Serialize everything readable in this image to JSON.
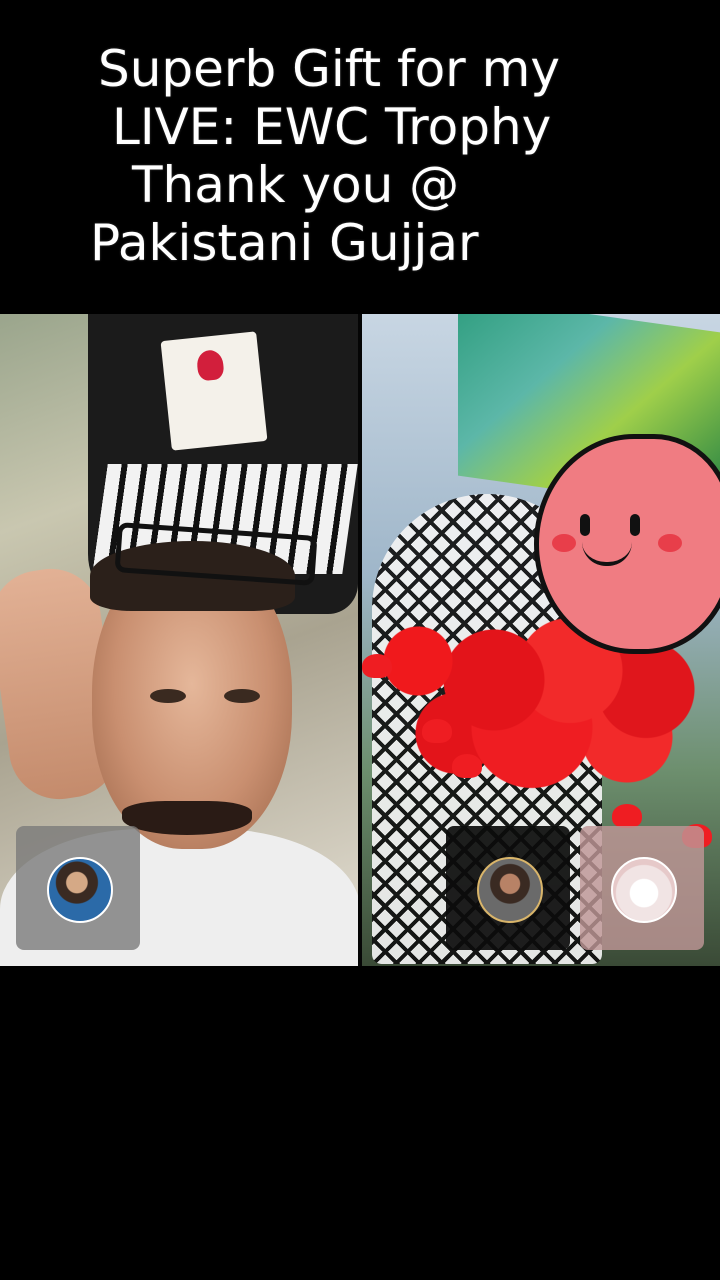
{
  "caption": {
    "lines": [
      "Superb Gift for my",
      "LIVE: EWC Trophy",
      "Thank you @",
      "Pakistani Gujjar"
    ]
  },
  "colors": {
    "background": "#000000",
    "caption_text": "#ffffff",
    "gift_heart": "#f07c82",
    "gift_pile": "#ef1d22"
  },
  "icons": {
    "gift_effect": "heart-character-icon"
  },
  "guests": [
    {
      "avatar": "avatar-icon"
    },
    {
      "avatar": "avatar-icon"
    },
    {
      "avatar": "avatar-icon"
    }
  ]
}
